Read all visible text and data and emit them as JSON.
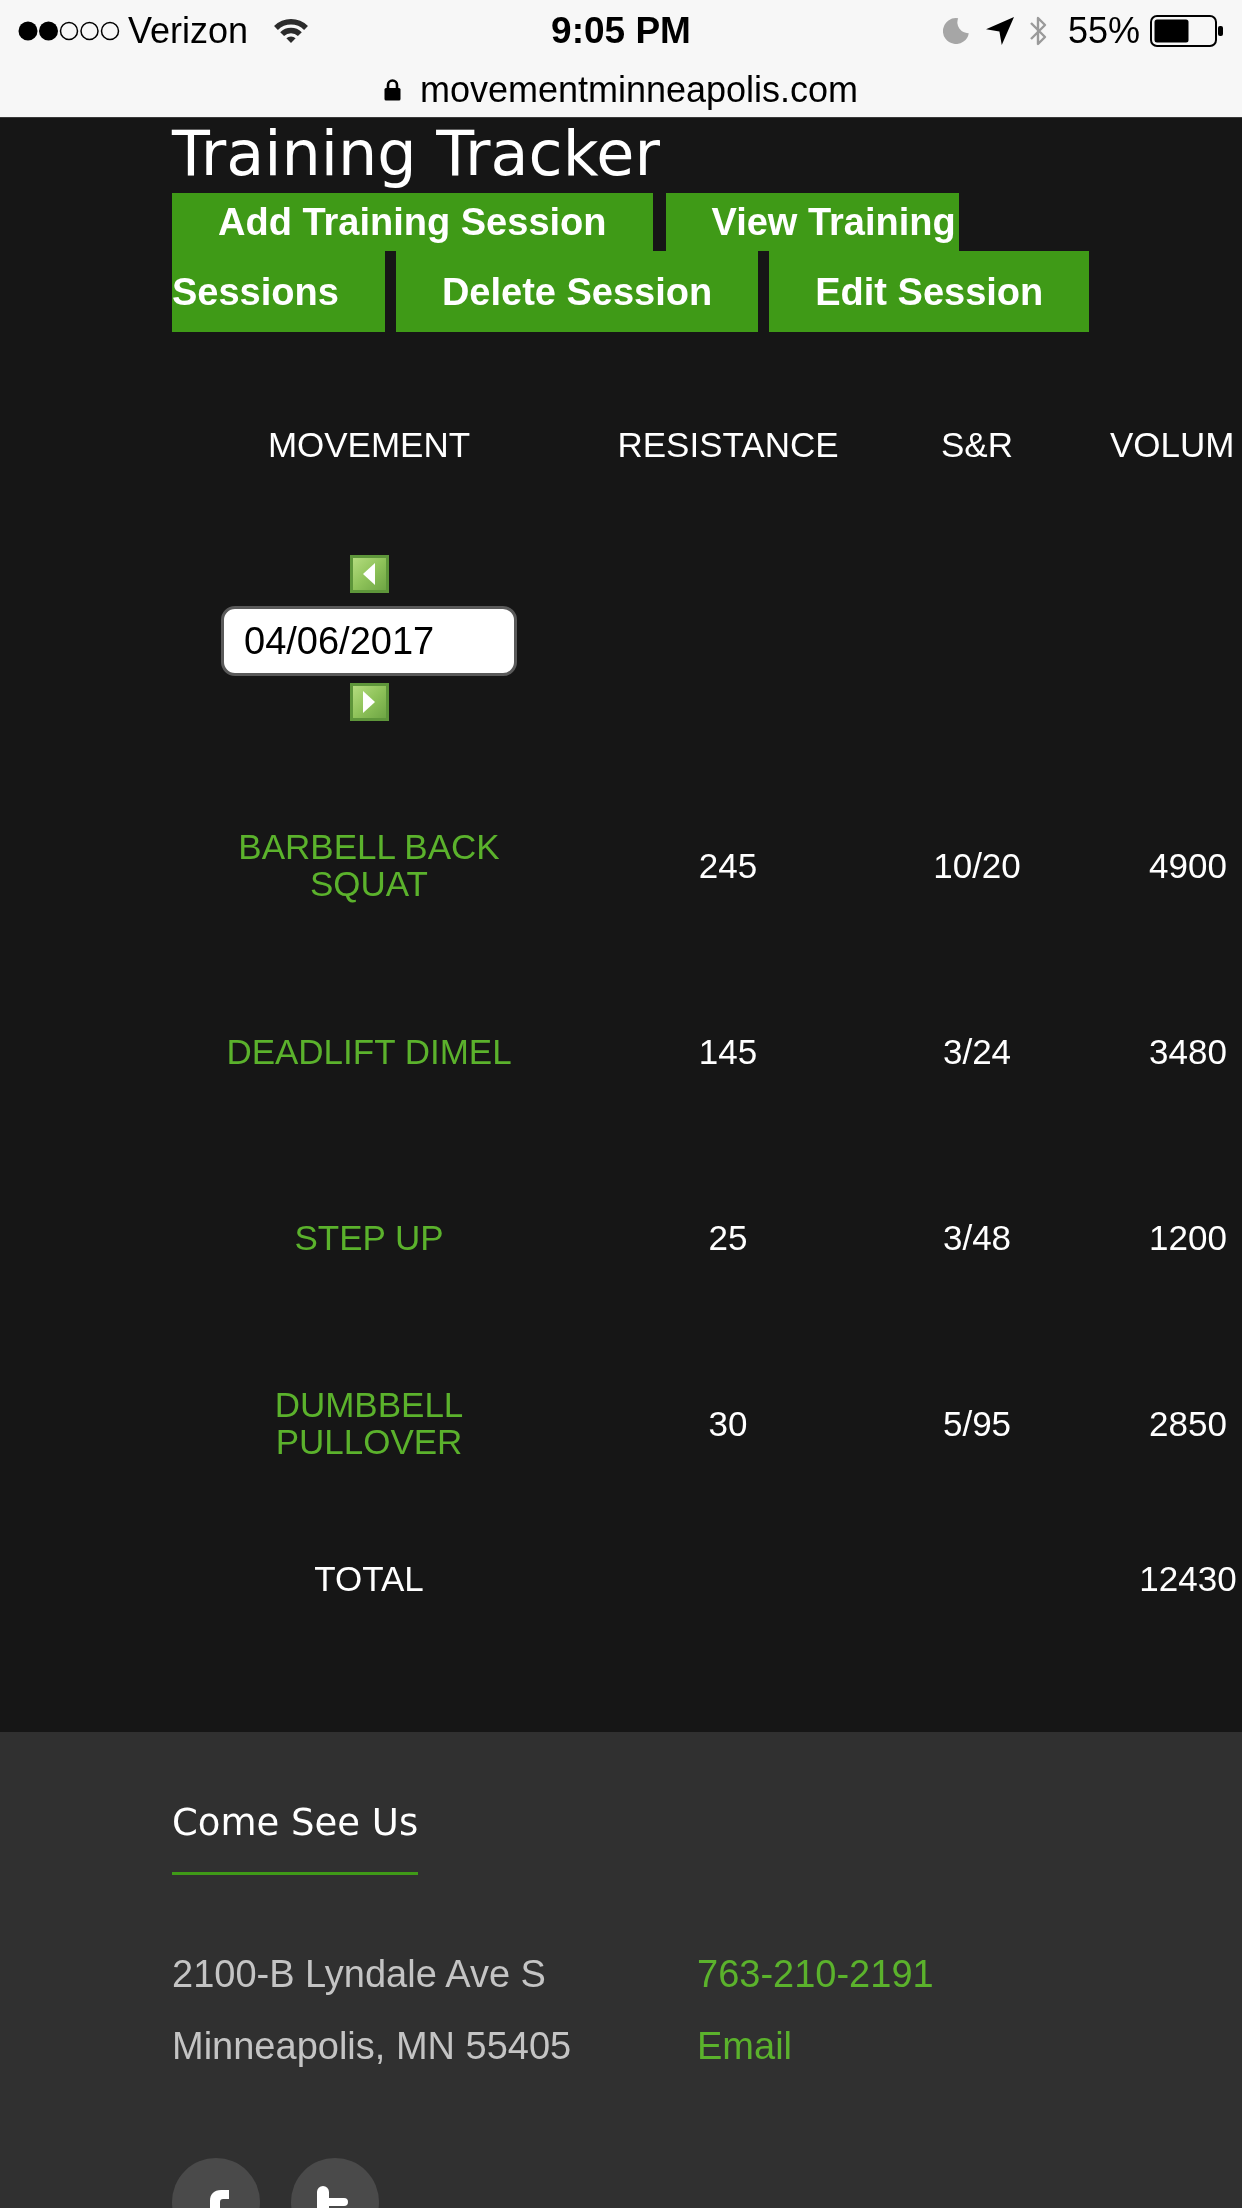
{
  "status_bar": {
    "carrier": "Verizon",
    "time": "9:05 PM",
    "battery": "55%"
  },
  "address_bar": {
    "url": "movementminneapolis.com"
  },
  "page": {
    "title": "Training Tracker",
    "buttons": [
      {
        "lines": [
          "Add Training Session"
        ]
      },
      {
        "lines": [
          "View Training",
          "Sessions"
        ]
      },
      {
        "lines": [
          "Delete Session"
        ]
      },
      {
        "lines": [
          "Edit Session"
        ]
      }
    ]
  },
  "table": {
    "columns": [
      "MOVEMENT",
      "RESISTANCE",
      "S&R",
      "VOLUM"
    ],
    "date_picker": {
      "value": "04/06/2017"
    },
    "rows": [
      {
        "cells": [
          "BARBELL BACK SQUAT",
          "245",
          "10/20",
          "4900"
        ]
      },
      {
        "cells": [
          "DEADLIFT DIMEL",
          "145",
          "3/24",
          "3480"
        ]
      },
      {
        "cells": [
          "STEP UP",
          "25",
          "3/48",
          "1200"
        ]
      },
      {
        "cells": [
          "DUMBBELL PULLOVER",
          "30",
          "5/95",
          "2850"
        ]
      }
    ],
    "total": {
      "label": "TOTAL",
      "volume": "12430"
    }
  },
  "footer": {
    "heading": "Come See Us",
    "address": [
      "2100-B Lyndale Ave S",
      "Minneapolis, MN 55405"
    ],
    "links": [
      "763-210-2191",
      "Email"
    ]
  }
}
